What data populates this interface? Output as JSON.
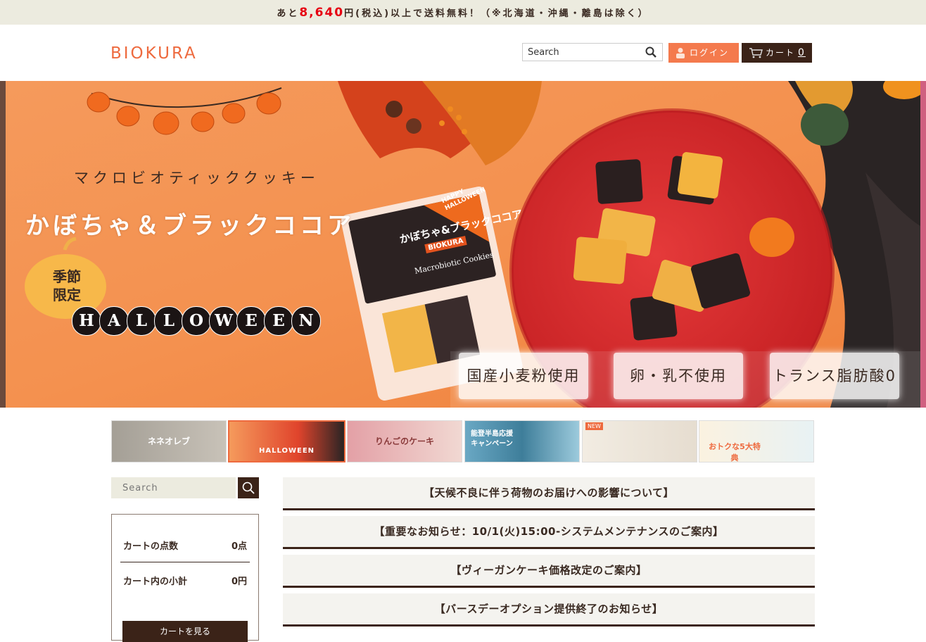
{
  "topbar": {
    "prefix": "あと",
    "amount": "8,640",
    "suffix": "円(税込)以上で送料無料！（※北海道・沖縄・離島は除く）"
  },
  "header": {
    "logo": "BIOKURA",
    "search_placeholder": "Search",
    "login_label": "ログイン",
    "cart_label": "カート",
    "cart_count": "0"
  },
  "hero": {
    "subtitle": "マクロビオティッククッキー",
    "title": "かぼちゃ＆ブラックココア",
    "season_badge": "季節限定",
    "halloween_letters": [
      "H",
      "A",
      "L",
      "L",
      "O",
      "W",
      "E",
      "E",
      "N"
    ],
    "package_brand": "BIOKURA",
    "package_name": "かぼちゃ&ブラックココア",
    "package_sub": "Macrobiotic Cookies",
    "package_tag": "HAPPY HALLOWEEN",
    "features": [
      "国産小麦粉使用",
      "卵・乳不使用",
      "トランス脂肪酸0"
    ]
  },
  "thumbnails": [
    {
      "label": "ネネオレブ",
      "active": false
    },
    {
      "label": "HALLOWEEN",
      "active": true
    },
    {
      "label": "りんごのケーキ",
      "active": false
    },
    {
      "label": "能登半島応援キャンペーン",
      "active": false
    },
    {
      "label": "NEW",
      "active": false
    },
    {
      "label": "おトクな5大特典",
      "active": false
    }
  ],
  "sidebar": {
    "search_placeholder": "Search",
    "cart_items_label": "カートの点数",
    "cart_items_value": "0点",
    "cart_subtotal_label": "カート内の小計",
    "cart_subtotal_value": "0円",
    "cart_button": "カートを見る"
  },
  "news": [
    "【天候不良に伴う荷物のお届けへの影響について】",
    "【重要なお知らせ：10/1(火)15:00-システムメンテナンスのご案内】",
    "【ヴィーガンケーキ価格改定のご案内】",
    "【バースデーオプション提供終了のお知らせ】"
  ],
  "colors": {
    "accent": "#ee6a3e",
    "dark_brown": "#3b2318",
    "topbar_bg": "#ecebdf",
    "price_red": "#e60012"
  }
}
